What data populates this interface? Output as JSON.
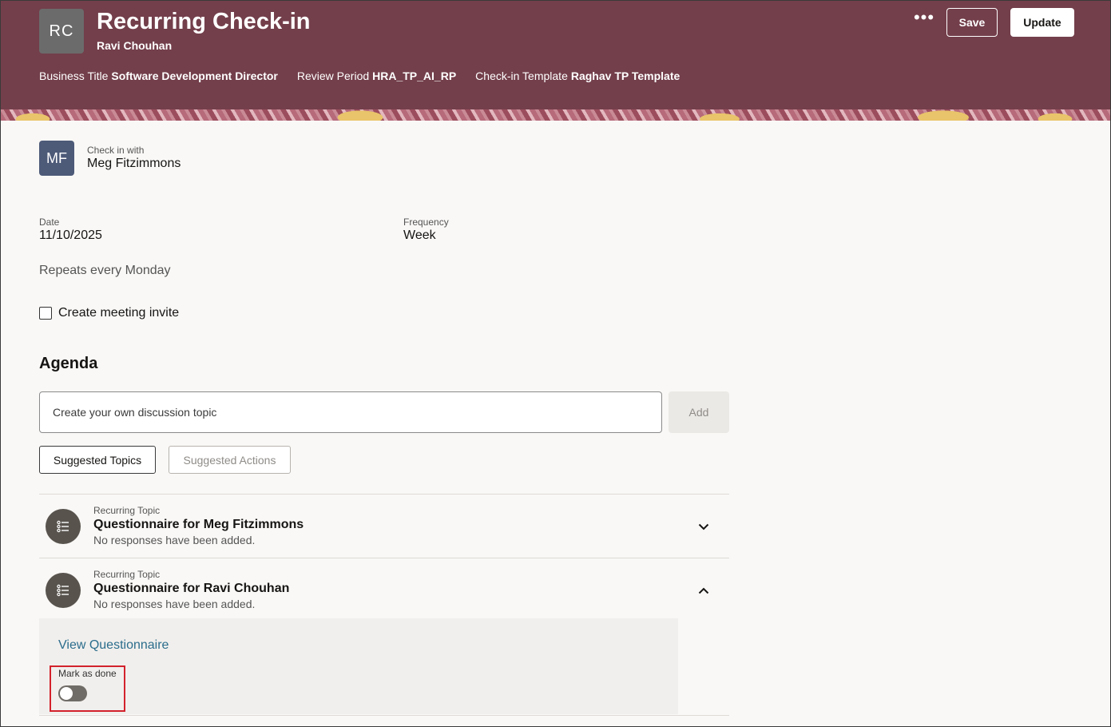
{
  "header": {
    "avatar_initials": "RC",
    "title": "Recurring Check-in",
    "subtitle": "Ravi Chouhan",
    "meta": [
      {
        "label": "Business Title",
        "value": "Software Development Director"
      },
      {
        "label": "Review Period",
        "value": "HRA_TP_AI_RP"
      },
      {
        "label": "Check-in Template",
        "value": "Raghav TP Template"
      }
    ],
    "more_label": "•••",
    "save_label": "Save",
    "update_label": "Update",
    "background_color": "#733f4b"
  },
  "checkin": {
    "avatar_initials": "MF",
    "label": "Check in with",
    "name": "Meg Fitzimmons"
  },
  "fields": {
    "date_label": "Date",
    "date_value": "11/10/2025",
    "frequency_label": "Frequency",
    "frequency_value": "Week",
    "repeats_text": "Repeats every Monday"
  },
  "invite": {
    "label": "Create meeting invite",
    "checked": false
  },
  "agenda": {
    "title": "Agenda",
    "input_placeholder": "Create your own discussion topic",
    "add_label": "Add",
    "suggested_topics_label": "Suggested Topics",
    "suggested_actions_label": "Suggested Actions",
    "topics": [
      {
        "kind": "Recurring Topic",
        "title": "Questionnaire for Meg Fitzimmons",
        "status": "No responses have been added.",
        "expanded": false
      },
      {
        "kind": "Recurring Topic",
        "title": "Questionnaire for Ravi Chouhan",
        "status": "No responses have been added.",
        "expanded": true
      }
    ],
    "expanded": {
      "view_link": "View Questionnaire",
      "mark_done_label": "Mark as done",
      "mark_done_on": false
    }
  },
  "colors": {
    "link": "#2b6d8c",
    "highlight": "#d3222c"
  }
}
